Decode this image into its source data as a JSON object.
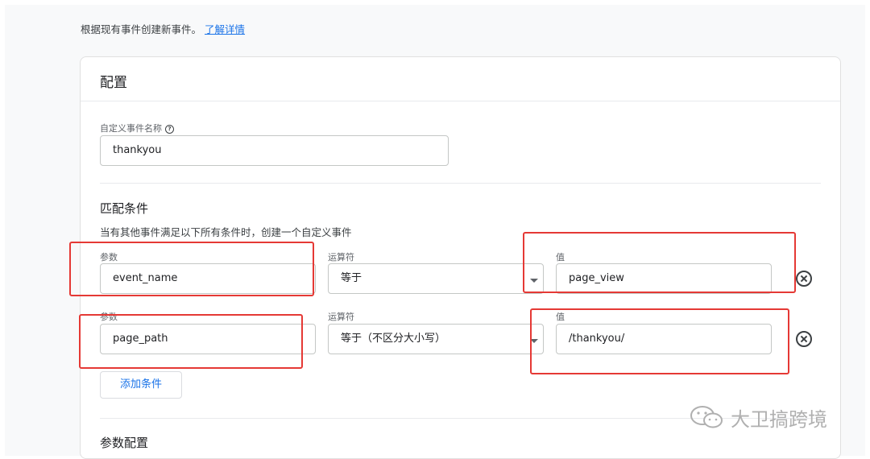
{
  "intro": {
    "text": "根据现有事件创建新事件。",
    "link": "了解详情"
  },
  "config": {
    "title": "配置",
    "custom_event_name": {
      "label": "自定义事件名称",
      "help_icon": "?",
      "value": "thankyou"
    },
    "matching": {
      "title": "匹配条件",
      "description": "当有其他事件满足以下所有条件时，创建一个自定义事件",
      "conditions": [
        {
          "param_label": "参数",
          "param_value": "event_name",
          "operator_label": "运算符",
          "operator_value": "等于",
          "value_label": "值",
          "value_value": "page_view"
        },
        {
          "param_label": "参数",
          "param_value": "page_path",
          "operator_label": "运算符",
          "operator_value": "等于（不区分大小写）",
          "value_label": "值",
          "value_value": "/thankyou/"
        }
      ],
      "add_condition_label": "添加条件"
    },
    "param_config": {
      "title": "参数配置"
    }
  },
  "watermark": {
    "text": "大卫搞跨境",
    "icon": "wechat-icon"
  },
  "colors": {
    "link": "#1a73e8",
    "highlight": "#e53935"
  }
}
